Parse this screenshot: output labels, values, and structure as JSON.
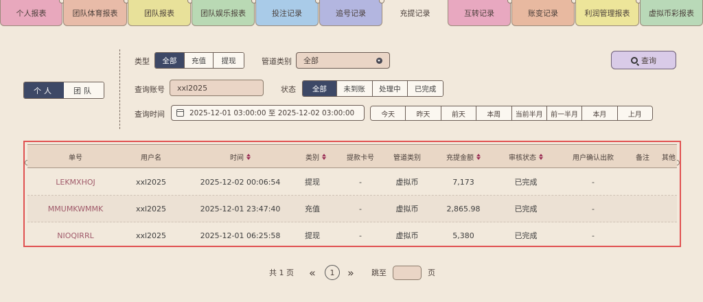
{
  "tabs": [
    {
      "label": "个人报表",
      "color": "#e8a8bd"
    },
    {
      "label": "团队体育报表",
      "color": "#e8bba8"
    },
    {
      "label": "团队报表",
      "color": "#e8e19a"
    },
    {
      "label": "团队娱乐报表",
      "color": "#b9d9b4"
    },
    {
      "label": "投注记录",
      "color": "#a9cbe8"
    },
    {
      "label": "追号记录",
      "color": "#b3b6e0"
    },
    {
      "label": "充提记录",
      "color": "transparent"
    },
    {
      "label": "互转记录",
      "color": "#e8a8c0"
    },
    {
      "label": "账变记录",
      "color": "#e8b9a0"
    },
    {
      "label": "利润管理报表",
      "color": "#ede59a"
    },
    {
      "label": "虚拟币彩报表",
      "color": "#b9d9b8"
    }
  ],
  "scope": {
    "personal": "个人",
    "team": "团队"
  },
  "filters": {
    "type_label": "类型",
    "type_options": [
      "全部",
      "充值",
      "提现"
    ],
    "channel_label": "管道类别",
    "channel_value": "全部",
    "account_label": "查询账号",
    "account_value": "xxl2025",
    "status_label": "状态",
    "status_options": [
      "全部",
      "未到账",
      "处理中",
      "已完成"
    ],
    "time_label": "查询时间",
    "time_value": "2025-12-01 03:00:00 至 2025-12-02 03:00:00",
    "quick_ranges": [
      "今天",
      "昨天",
      "前天",
      "本周",
      "当前半月",
      "前一半月",
      "本月",
      "上月"
    ],
    "query_button": "查询"
  },
  "table": {
    "headers": [
      "单号",
      "用户名",
      "时间",
      "类别",
      "提款卡号",
      "管道类别",
      "充提金额",
      "审核状态",
      "用户确认出款",
      "备注",
      "其他"
    ],
    "rows": [
      {
        "id": "LEKMXHOJ",
        "user": "xxl2025",
        "time": "2025-12-02 00:06:54",
        "type": "提现",
        "card": "-",
        "channel": "虚拟币",
        "amount": "7,173",
        "status": "已完成",
        "confirm": "-"
      },
      {
        "id": "MMUMKWMMK",
        "user": "xxl2025",
        "time": "2025-12-01 23:47:40",
        "type": "充值",
        "card": "-",
        "channel": "虚拟币",
        "amount": "2,865.98",
        "status": "已完成",
        "confirm": "-"
      },
      {
        "id": "NIOQIRRL",
        "user": "xxl2025",
        "time": "2025-12-01 06:25:58",
        "type": "提现",
        "card": "-",
        "channel": "虚拟币",
        "amount": "5,380",
        "status": "已完成",
        "confirm": "-"
      }
    ]
  },
  "pagination": {
    "total": "共 1 页",
    "prev": "«",
    "current": "1",
    "next": "»",
    "jump_label": "跳至",
    "page_suffix": "页"
  }
}
